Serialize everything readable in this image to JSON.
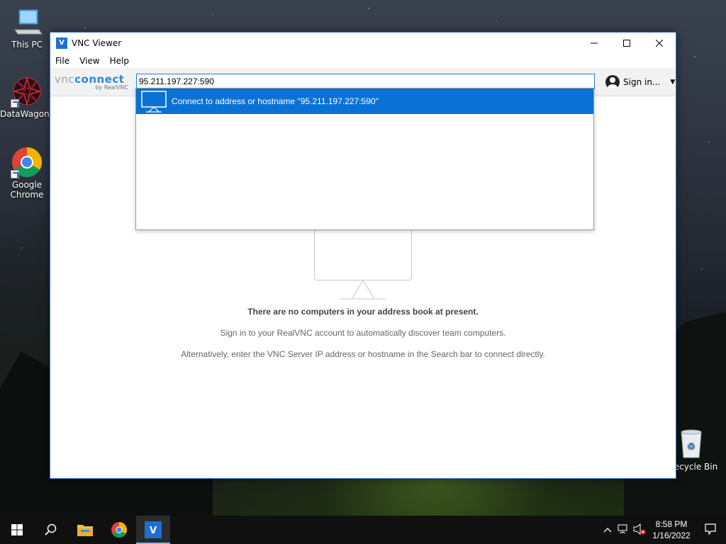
{
  "desktop": {
    "icons": [
      {
        "label": "This PC"
      },
      {
        "label": "DataWagon..."
      },
      {
        "label": "Google Chrome"
      },
      {
        "label": "Recycle Bin"
      }
    ]
  },
  "window": {
    "title": "VNC Viewer",
    "menu": [
      "File",
      "View",
      "Help"
    ],
    "logo": {
      "brand": "connect",
      "prefix": "vnc",
      "sub": "by RealVNC"
    },
    "search": {
      "value": "95.211.197.227:590"
    },
    "signin_label": "Sign in...",
    "dropdown": {
      "suggestion": "Connect to address or hostname \"95.211.197.227:590\""
    },
    "empty_state": {
      "heading": "There are no computers in your address book at present.",
      "line1": "Sign in to your RealVNC account to automatically discover team computers.",
      "line2": "Alternatively, enter the VNC Server IP address or hostname in the Search bar to connect directly."
    }
  },
  "taskbar": {
    "time": "8:58 PM",
    "date": "1/16/2022",
    "apps": [
      "start-icon",
      "search-icon",
      "file-explorer-icon",
      "chrome-icon",
      "vnc-viewer-icon"
    ]
  },
  "colors": {
    "accent": "#0a72d4",
    "brand": "#2f87d6",
    "taskbar": "#101010"
  }
}
